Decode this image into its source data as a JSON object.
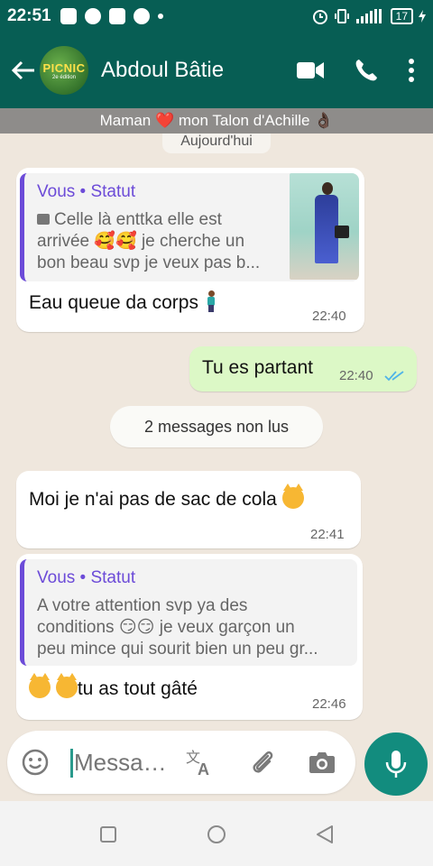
{
  "status_bar": {
    "time": "22:51",
    "battery": "17"
  },
  "header": {
    "contact_name": "Abdoul Bâtie",
    "avatar_logo": "PICNIC",
    "avatar_logo_sub": "2e édition",
    "accent": "#075e54"
  },
  "banner": {
    "text": "Maman ❤️ mon Talon d'Achille 👌🏿"
  },
  "chat": {
    "date_chip": "Aujourd'hui",
    "messages": [
      {
        "direction": "incoming",
        "quote_author": "Vous • Statut",
        "quote_lines": [
          "Celle là enttka elle est",
          "arrivée 🥰🥰 je cherche un",
          "bon beau svp je veux pas b..."
        ],
        "text": "Eau queue da corps",
        "time": "22:40"
      },
      {
        "direction": "outgoing",
        "text": "Tu es partant",
        "time": "22:40",
        "read": true
      },
      {
        "direction": "incoming",
        "text": "Moi je n'ai pas de sac de cola",
        "time": "22:41"
      },
      {
        "direction": "incoming",
        "quote_author": "Vous • Statut",
        "quote_lines": [
          "A votre attention svp ya des",
          "conditions 😏😏 je veux garçon un",
          "peu mince qui sourit bien un peu gr..."
        ],
        "text": "tu as tout gâté",
        "time": "22:46"
      }
    ],
    "unread_chip": "2 messages non lus"
  },
  "composer": {
    "placeholder": "Messa…",
    "icons": [
      "emoji-icon",
      "translate-icon",
      "attach-icon",
      "camera-icon",
      "mic-icon"
    ]
  },
  "colors": {
    "bubble_out": "#dcf8c6",
    "quote_author": "#6c4bd8",
    "mic_button": "#128c7e",
    "read_ticks": "#4fb3e8"
  }
}
